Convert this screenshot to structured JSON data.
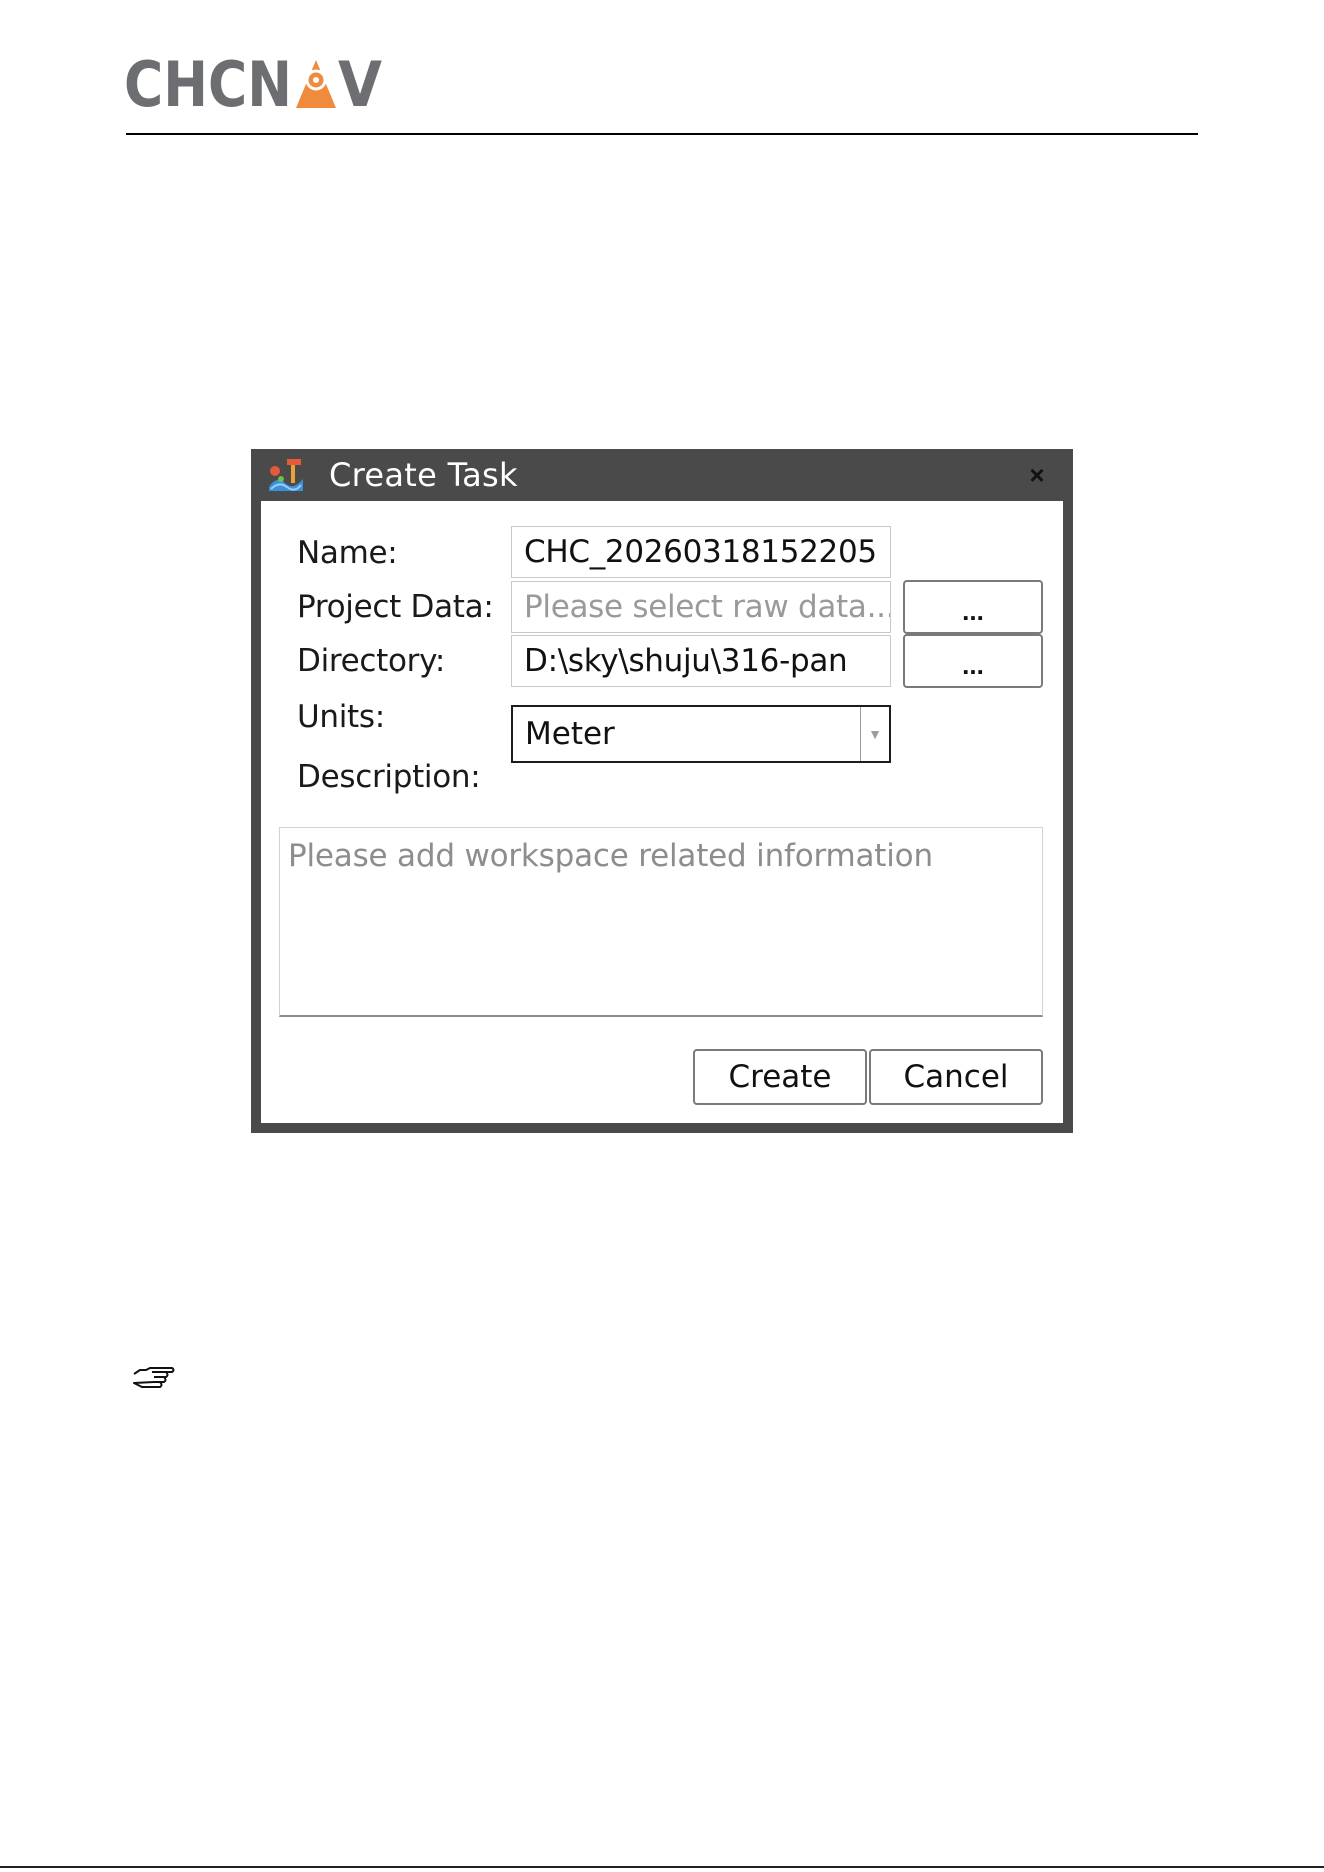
{
  "header": {
    "logo_text": "CHCNAV",
    "logo_icon": "location-pin-icon",
    "brand_colors": {
      "text": "#6d6e71",
      "accent": "#f08a3c"
    }
  },
  "dialog": {
    "title": "Create Task",
    "app_icon": "task-app-icon",
    "close_icon": "close-icon",
    "close_glyph": "×",
    "fields": {
      "name": {
        "label": "Name:",
        "value": "CHC_20260318152205"
      },
      "project_data": {
        "label": "Project Data:",
        "placeholder": "Please select raw data...",
        "browse_label": "..."
      },
      "directory": {
        "label": "Directory:",
        "value": "D:\\sky\\shuju\\316-pan",
        "browse_label": "..."
      },
      "units": {
        "label": "Units:",
        "selected": "Meter",
        "arrow_glyph": "▼"
      },
      "description": {
        "label": "Description:",
        "placeholder": "Please add workspace related information"
      }
    },
    "buttons": {
      "create": "Create",
      "cancel": "Cancel"
    }
  },
  "note_icon": "pointing-hand-icon"
}
